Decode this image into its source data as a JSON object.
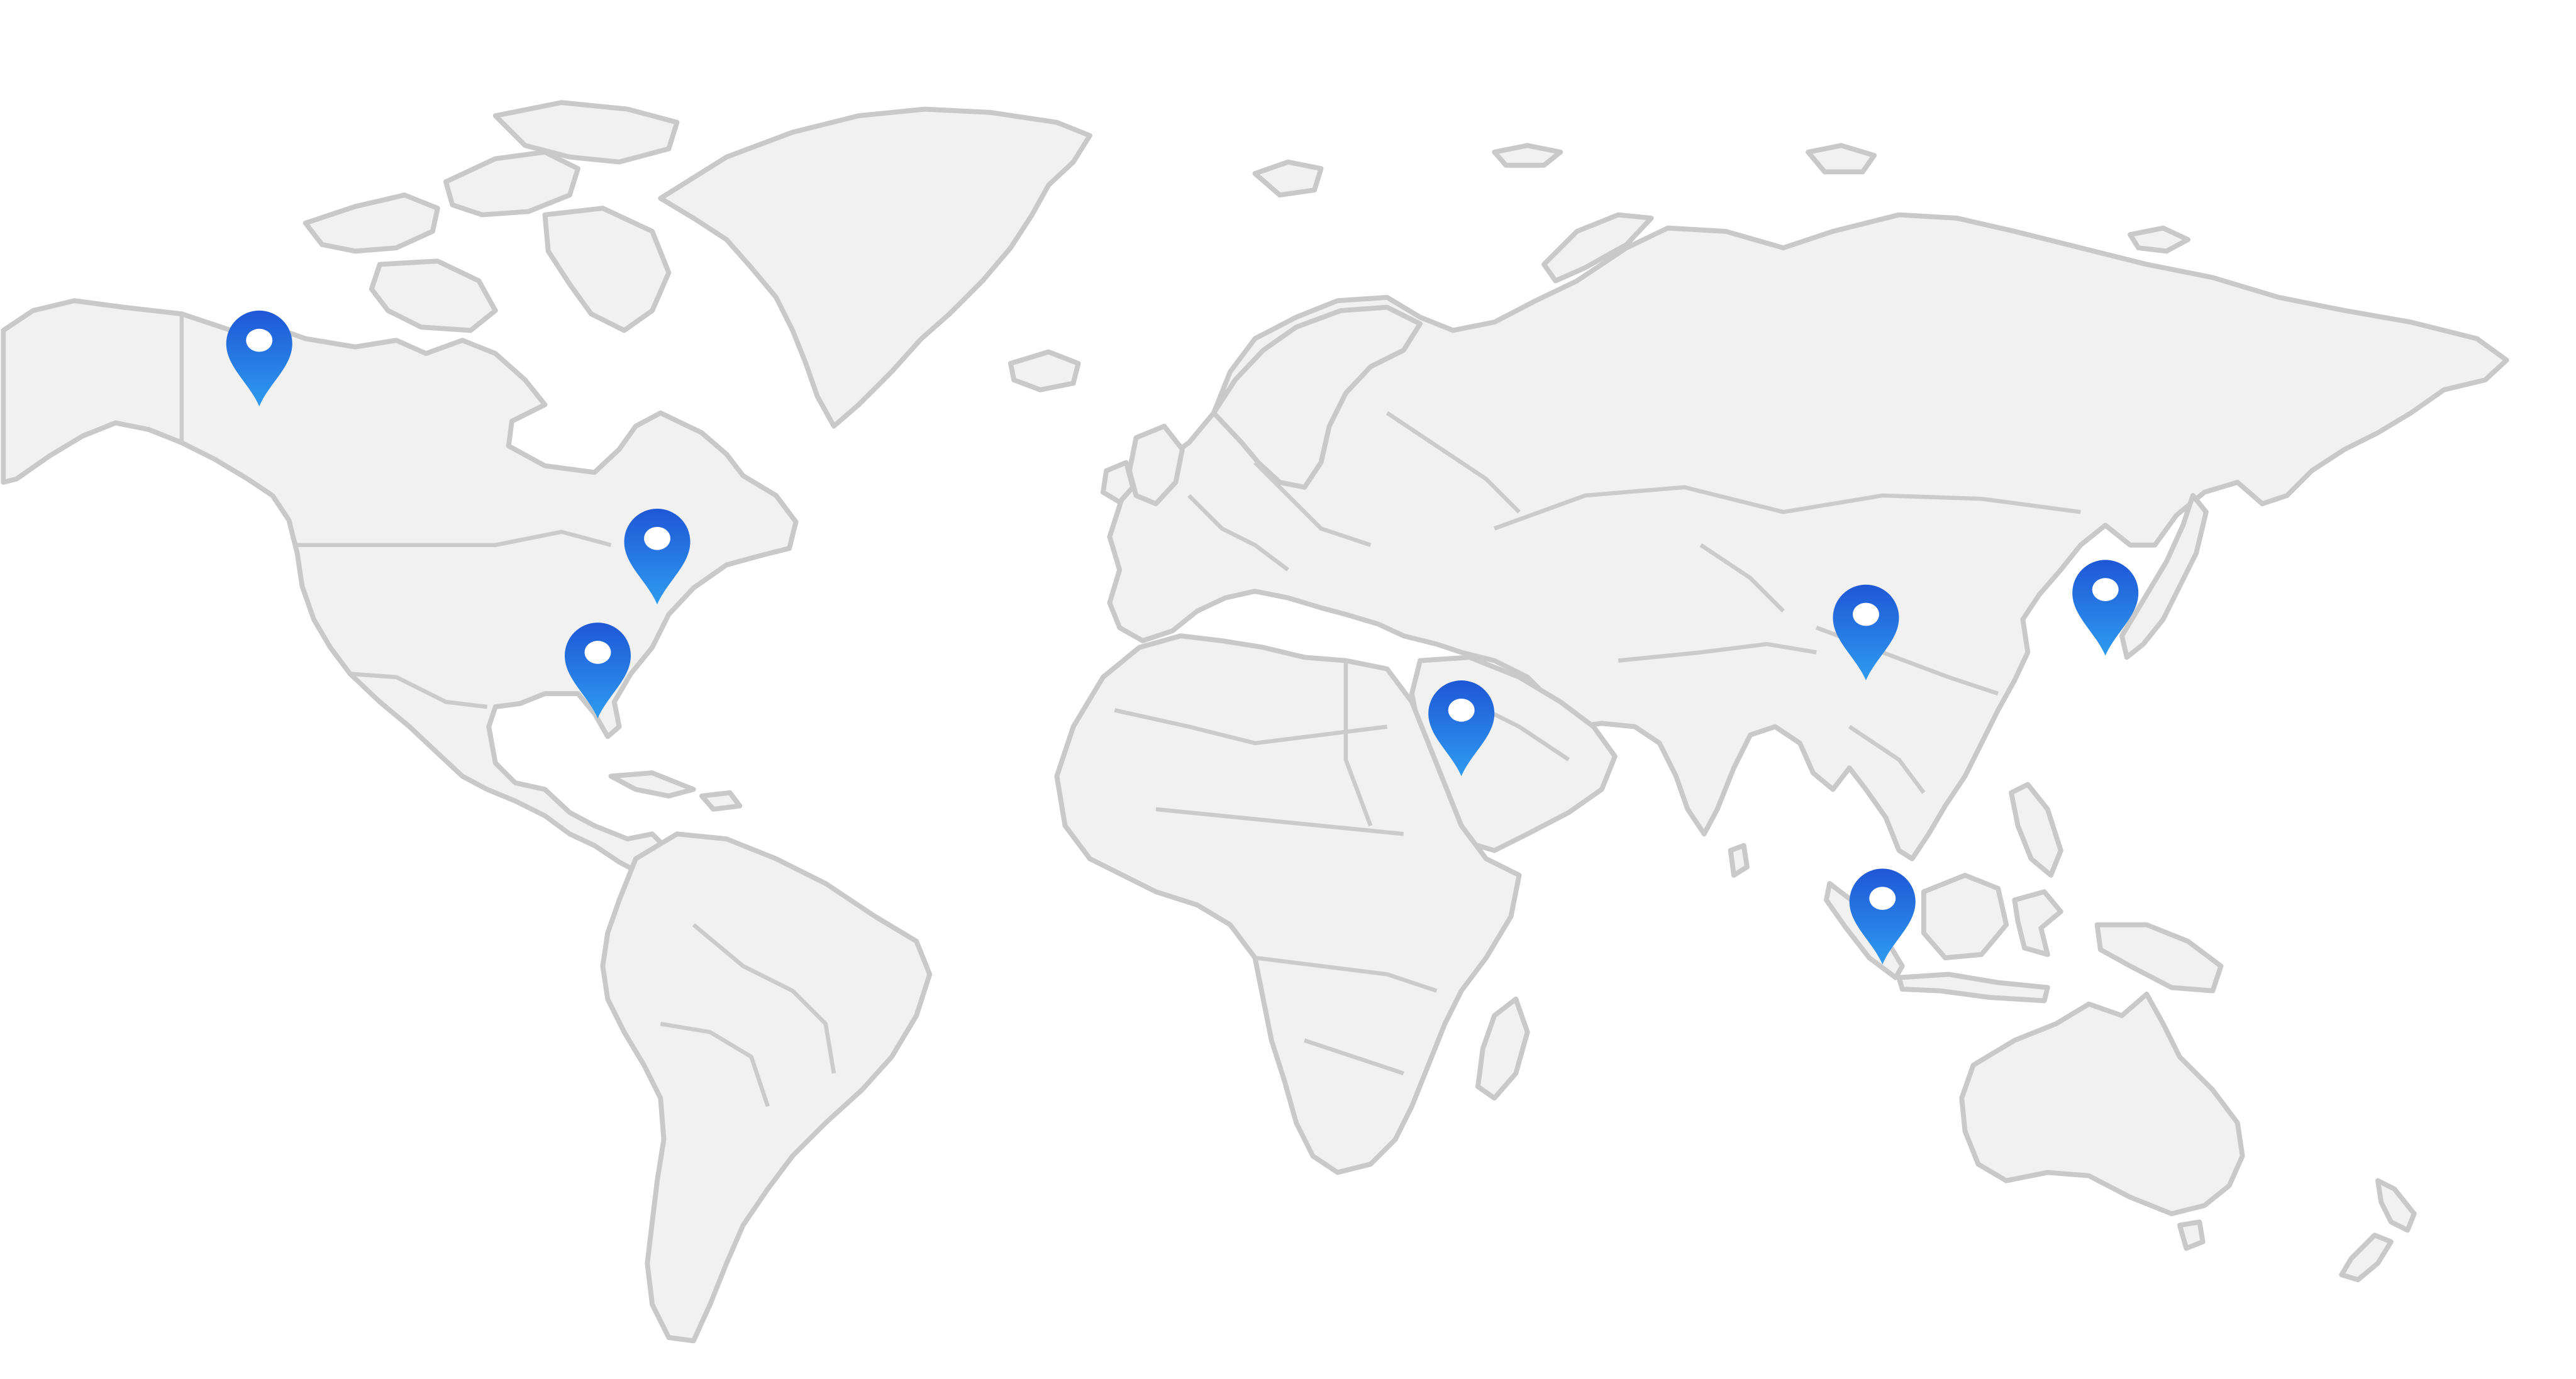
{
  "map": {
    "background": "#ffffff",
    "land_fill": "#f1f1f1",
    "land_stroke": "#c9c9c9",
    "marker_color_top": "#1f57d6",
    "marker_color_bottom": "#2e9bf0",
    "marker_hole_color": "#ffffff",
    "marker_icon": "map-pin-icon",
    "marker_count": 7
  }
}
